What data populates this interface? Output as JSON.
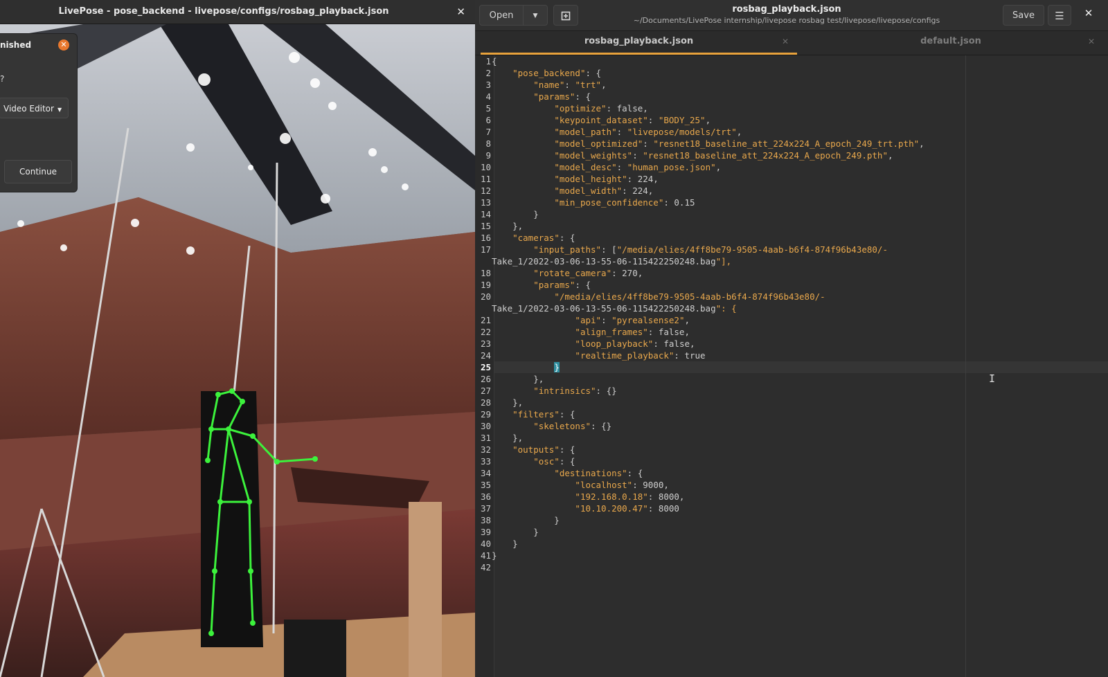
{
  "video_window": {
    "title": "LivePose - pose_backend - livepose/configs/rosbag_playback.json",
    "close_glyph": "✕",
    "dialog": {
      "title": "nished",
      "question": "?",
      "select_value": "Video Editor",
      "continue_label": "Continue",
      "close_glyph": "✕"
    }
  },
  "editor": {
    "open_label": "Open",
    "save_label": "Save",
    "menu_glyph": "☰",
    "close_glyph": "✕",
    "title": "rosbag_playback.json",
    "path": "~/Documents/LivePose internship/livepose rosbag test/livepose/livepose/configs",
    "tabs": [
      {
        "label": "rosbag_playback.json",
        "active": true
      },
      {
        "label": "default.json",
        "active": false
      }
    ],
    "tab_close_glyph": "✕",
    "current_line": 25,
    "lines": [
      {
        "n": "1",
        "t": "{"
      },
      {
        "n": "2",
        "t": "    \"pose_backend\": {"
      },
      {
        "n": "3",
        "t": "        \"name\": \"trt\","
      },
      {
        "n": "4",
        "t": "        \"params\": {"
      },
      {
        "n": "5",
        "t": "            \"optimize\": false,"
      },
      {
        "n": "6",
        "t": "            \"keypoint_dataset\": \"BODY_25\","
      },
      {
        "n": "7",
        "t": "            \"model_path\": \"livepose/models/trt\","
      },
      {
        "n": "8",
        "t": "            \"model_optimized\": \"resnet18_baseline_att_224x224_A_epoch_249_trt.pth\","
      },
      {
        "n": "9",
        "t": "            \"model_weights\": \"resnet18_baseline_att_224x224_A_epoch_249.pth\","
      },
      {
        "n": "10",
        "t": "            \"model_desc\": \"human_pose.json\","
      },
      {
        "n": "11",
        "t": "            \"model_height\": 224,"
      },
      {
        "n": "12",
        "t": "            \"model_width\": 224,"
      },
      {
        "n": "13",
        "t": "            \"min_pose_confidence\": 0.15"
      },
      {
        "n": "14",
        "t": "        }"
      },
      {
        "n": "15",
        "t": "    },"
      },
      {
        "n": "16",
        "t": "    \"cameras\": {"
      },
      {
        "n": "17",
        "t": "        \"input_paths\": [\"/media/elies/4ff8be79-9505-4aab-b6f4-874f96b43e80/-"
      },
      {
        "n": "",
        "t": "Take_1/2022-03-06-13-55-06-115422250248.bag\"],"
      },
      {
        "n": "18",
        "t": "        \"rotate_camera\": 270,"
      },
      {
        "n": "19",
        "t": "        \"params\": {"
      },
      {
        "n": "20",
        "t": "            \"/media/elies/4ff8be79-9505-4aab-b6f4-874f96b43e80/-"
      },
      {
        "n": "",
        "t": "Take_1/2022-03-06-13-55-06-115422250248.bag\": {"
      },
      {
        "n": "21",
        "t": "                \"api\": \"pyrealsense2\","
      },
      {
        "n": "22",
        "t": "                \"align_frames\": false,"
      },
      {
        "n": "23",
        "t": "                \"loop_playback\": false,"
      },
      {
        "n": "24",
        "t": "                \"realtime_playback\": true"
      },
      {
        "n": "25",
        "t": "            }"
      },
      {
        "n": "26",
        "t": "        },"
      },
      {
        "n": "27",
        "t": "        \"intrinsics\": {}"
      },
      {
        "n": "28",
        "t": "    },"
      },
      {
        "n": "29",
        "t": "    \"filters\": {"
      },
      {
        "n": "30",
        "t": "        \"skeletons\": {}"
      },
      {
        "n": "31",
        "t": "    },"
      },
      {
        "n": "32",
        "t": "    \"outputs\": {"
      },
      {
        "n": "33",
        "t": "        \"osc\": {"
      },
      {
        "n": "34",
        "t": "            \"destinations\": {"
      },
      {
        "n": "35",
        "t": "                \"localhost\": 9000,"
      },
      {
        "n": "36",
        "t": "                \"192.168.0.18\": 8000,"
      },
      {
        "n": "37",
        "t": "                \"10.10.200.47\": 8000"
      },
      {
        "n": "38",
        "t": "            }"
      },
      {
        "n": "39",
        "t": "        }"
      },
      {
        "n": "40",
        "t": "    }"
      },
      {
        "n": "41",
        "t": "}"
      },
      {
        "n": "42",
        "t": ""
      }
    ]
  },
  "colors": {
    "string": "#e9a84c",
    "text": "#cfcfcf",
    "accent": "#e8a23c",
    "skeleton": "#3cf23c",
    "bracket_match": "#2f8fa0"
  }
}
